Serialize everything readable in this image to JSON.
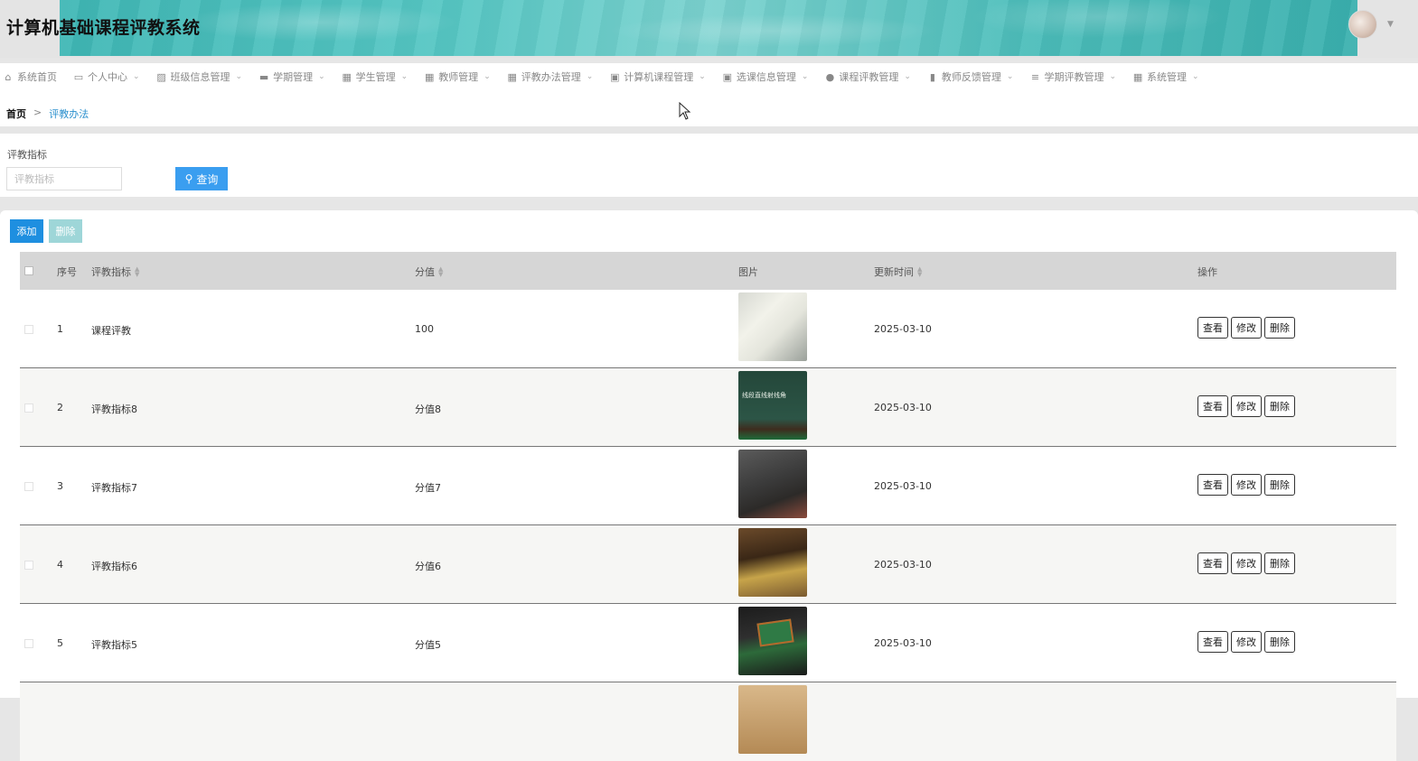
{
  "app": {
    "title": "计算机基础课程评教系统"
  },
  "nav": [
    {
      "label": "系统首页",
      "icon": "home-icon"
    },
    {
      "label": "个人中心",
      "icon": "card-icon"
    },
    {
      "label": "班级信息管理",
      "icon": "chart-icon"
    },
    {
      "label": "学期管理",
      "icon": "briefcase-icon"
    },
    {
      "label": "学生管理",
      "icon": "grid-icon"
    },
    {
      "label": "教师管理",
      "icon": "grid-icon"
    },
    {
      "label": "评教办法管理",
      "icon": "grid-icon"
    },
    {
      "label": "计算机课程管理",
      "icon": "clipboard-icon"
    },
    {
      "label": "选课信息管理",
      "icon": "clipboard-icon"
    },
    {
      "label": "课程评教管理",
      "icon": "pin-icon"
    },
    {
      "label": "教师反馈管理",
      "icon": "bars-icon"
    },
    {
      "label": "学期评教管理",
      "icon": "menu-icon"
    },
    {
      "label": "系统管理",
      "icon": "grid-icon"
    }
  ],
  "breadcrumb": {
    "home": "首页",
    "separator": ">",
    "current": "评教办法"
  },
  "search": {
    "label": "评教指标",
    "placeholder": "评教指标",
    "button": "查询"
  },
  "toolbar": {
    "add": "添加",
    "delete": "删除"
  },
  "table": {
    "headers": {
      "index": "序号",
      "indicator": "评教指标",
      "score": "分值",
      "image": "图片",
      "updated": "更新时间",
      "actions": "操作"
    },
    "actions": {
      "view": "查看",
      "edit": "修改",
      "delete": "删除"
    },
    "rows": [
      {
        "index": "1",
        "indicator": "课程评教",
        "score": "100",
        "updated": "2025-03-10"
      },
      {
        "index": "2",
        "indicator": "评教指标8",
        "score": "分值8",
        "updated": "2025-03-10"
      },
      {
        "index": "3",
        "indicator": "评教指标7",
        "score": "分值7",
        "updated": "2025-03-10"
      },
      {
        "index": "4",
        "indicator": "评教指标6",
        "score": "分值6",
        "updated": "2025-03-10"
      },
      {
        "index": "5",
        "indicator": "评教指标5",
        "score": "分值5",
        "updated": "2025-03-10"
      }
    ],
    "thumb2_text": "线段直线射线角",
    "thumb5_text": "数 学"
  }
}
